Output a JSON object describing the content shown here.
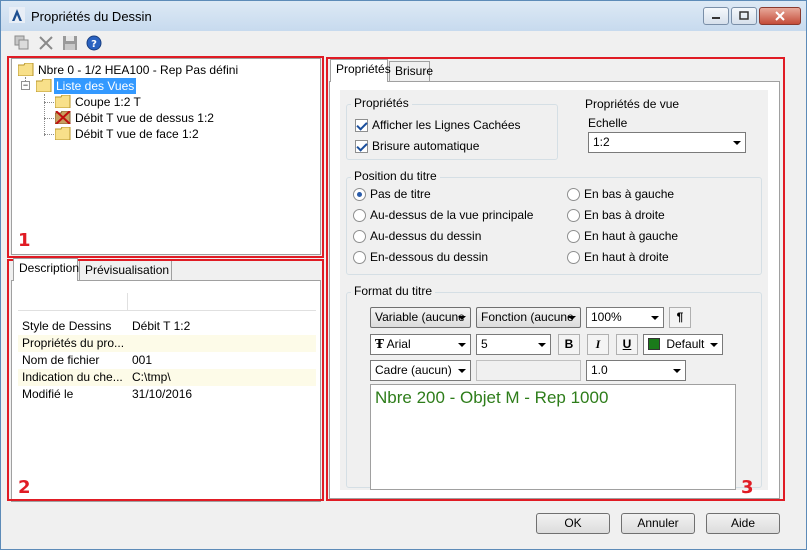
{
  "window": {
    "title": "Propriétés du Dessin"
  },
  "toolbar": {
    "icons": [
      "copy-icon",
      "delete-icon",
      "save-icon",
      "help-icon"
    ]
  },
  "tree": {
    "root": "Nbre 0 - 1/2 HEA100  - Rep Pas défini",
    "expander": "−",
    "views_label": "Liste des Vues",
    "items": [
      "Coupe 1:2 T",
      "Débit T vue de dessus 1:2",
      "Débit T vue de face 1:2"
    ]
  },
  "annotations": {
    "one": "1",
    "two": "2",
    "three": "3"
  },
  "left_tabs": {
    "description": "Description",
    "preview": "Prévisualisation"
  },
  "description": {
    "rows": [
      {
        "key": "Style de Dessins",
        "value": "Débit T 1:2"
      },
      {
        "key": "Propriétés du pro...",
        "value": ""
      },
      {
        "key": "Nom de fichier",
        "value": "001"
      },
      {
        "key": "Indication du che...",
        "value": "C:\\tmp\\"
      },
      {
        "key": "Modifié le",
        "value": "31/10/2016"
      }
    ]
  },
  "right_tabs": {
    "properties": "Propriétés",
    "break": "Brisure"
  },
  "properties_group": {
    "title": "Propriétés",
    "hidden_lines": "Afficher les Lignes Cachées",
    "auto_break": "Brisure automatique"
  },
  "view_props": {
    "title": "Propriétés de vue",
    "scale_label": "Echelle",
    "scale_value": "1:2"
  },
  "title_position": {
    "title": "Position du titre",
    "options_left": [
      "Pas de titre",
      "Au-dessus de la vue principale",
      "Au-dessus du dessin",
      "En-dessous du dessin"
    ],
    "options_right": [
      "En bas à gauche",
      "En bas à droite",
      "En haut à gauche",
      "En haut à droite"
    ],
    "selected": "Pas de titre"
  },
  "title_format": {
    "title": "Format du titre",
    "variable": "Variable (aucune",
    "function": "Fonction (aucune",
    "zoom": "100%",
    "pilcrow": "¶",
    "font_icon": "Ŧ",
    "font": "Arial",
    "size": "5",
    "bold": "B",
    "italic": "I",
    "underline": "U",
    "color_name": "Default",
    "color_hex": "#1a7a1a",
    "frame": "Cadre (aucun)",
    "line_width": "1.0",
    "text": "Nbre 200 - Objet M - Rep 1000",
    "text_color": "#2e7d1a"
  },
  "buttons": {
    "ok": "OK",
    "cancel": "Annuler",
    "help": "Aide"
  }
}
